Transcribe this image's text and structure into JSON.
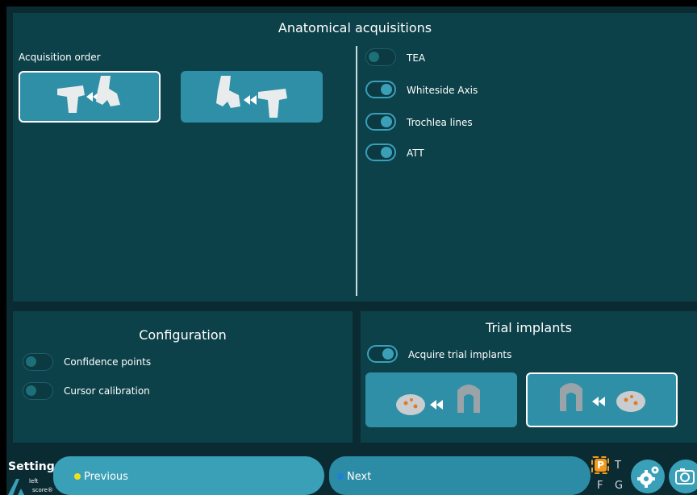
{
  "anatomical": {
    "title": "Anatomical acquisitions",
    "order_label": "Acquisition order",
    "order_options": [
      {
        "name": "tibia-to-femur",
        "selected": true
      },
      {
        "name": "femur-to-tibia",
        "selected": false
      }
    ],
    "toggles": [
      {
        "label": "TEA",
        "on": false
      },
      {
        "label": "Whiteside Axis",
        "on": true
      },
      {
        "label": "Trochlea lines",
        "on": true
      },
      {
        "label": "ATT",
        "on": true
      }
    ]
  },
  "configuration": {
    "title": "Configuration",
    "toggles": [
      {
        "label": "Confidence points",
        "on": false
      },
      {
        "label": "Cursor calibration",
        "on": false
      }
    ]
  },
  "trial": {
    "title": "Trial implants",
    "toggle_label": "Acquire trial implants",
    "toggle_on": true,
    "options": [
      {
        "name": "tibial-to-femoral-implant",
        "selected": false
      },
      {
        "name": "femoral-to-tibial-implant",
        "selected": true
      }
    ]
  },
  "footer": {
    "settings_label": "Settings",
    "side_label": "left",
    "brand_label": "score®",
    "previous_label": "Previous",
    "next_label": "Next",
    "indicator_p": "P",
    "indicator_t": "T",
    "indicator_f": "F",
    "indicator_g": "G"
  },
  "colors": {
    "background": "#0b2b33",
    "panel": "#0d4149",
    "accent": "#3aa0b8",
    "previous_dot": "#f0e020",
    "next_dot": "#1e7fd8",
    "indicator_orange": "#f39a1e"
  }
}
